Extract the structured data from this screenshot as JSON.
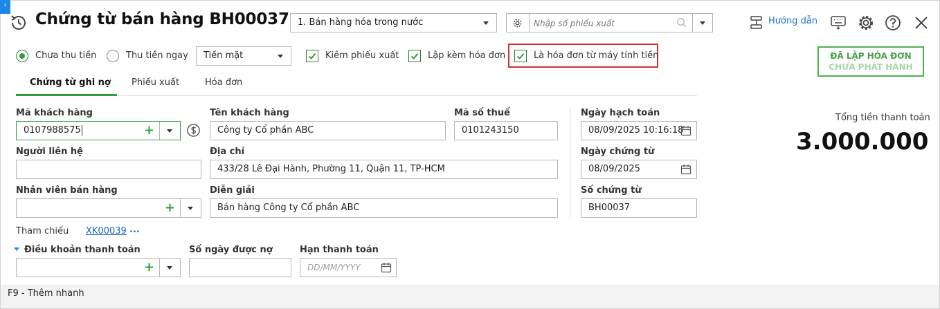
{
  "corner": {
    "glyph": "›"
  },
  "header": {
    "title": "Chứng từ bán hàng BH00037",
    "sale_type": "1. Bán hàng hóa trong nước",
    "search_placeholder": "Nhập số phiếu xuất",
    "guide_label": "Hướng dẫn"
  },
  "options": {
    "unpaid_label": "Chưa thu tiền",
    "paid_now_label": "Thu tiền ngay",
    "payment_method": "Tiền mặt",
    "with_delivery_label": "Kiêm phiếu xuất",
    "with_invoice_label": "Lập kèm hóa đơn",
    "cash_register_label": "Là hóa đơn từ máy tính tiền"
  },
  "status_badge": {
    "line1": "ĐÃ LẬP HÓA ĐƠN",
    "line2": "CHƯA PHÁT HÀNH"
  },
  "tabs": [
    {
      "label": "Chứng từ ghi nợ",
      "active": true
    },
    {
      "label": "Phiếu xuất",
      "active": false
    },
    {
      "label": "Hóa đơn",
      "active": false
    }
  ],
  "form": {
    "customer_code_label": "Mã khách hàng",
    "customer_code": "0107988575",
    "customer_name_label": "Tên khách hàng",
    "customer_name": "Công ty Cổ phần ABC",
    "tax_code_label": "Mã số thuế",
    "tax_code": "0101243150",
    "contact_label": "Người liên hệ",
    "contact": "",
    "address_label": "Địa chỉ",
    "address": "433/28 Lê Đại Hành, Phường 11, Quận 11, TP-HCM",
    "salesperson_label": "Nhân viên bán hàng",
    "salesperson": "",
    "description_label": "Diễn giải",
    "description": "Bán hàng Công ty Cổ phần ABC",
    "reference_label": "Tham chiếu",
    "reference_link": "XK00039",
    "reference_more": "...",
    "payment_terms_label": "Điều khoản thanh toán",
    "payment_terms": "",
    "credit_days_label": "Số ngày được nợ",
    "credit_days": "",
    "due_date_label": "Hạn thanh toán",
    "due_date_placeholder": "DD/MM/YYYY"
  },
  "dates": {
    "posting_date_label": "Ngày hạch toán",
    "posting_date": "08/09/2025 10:16:18",
    "voucher_date_label": "Ngày chứng từ",
    "voucher_date": "08/09/2025",
    "voucher_no_label": "Số chứng từ",
    "voucher_no": "BH00037"
  },
  "total": {
    "label": "Tổng tiền thanh toán",
    "value": "3.000.000"
  },
  "footer": {
    "hint": "F9 - Thêm nhanh"
  },
  "colors": {
    "accent_green": "#2e9e3f",
    "link_blue": "#1565c0",
    "highlight_red": "#d32f2f"
  }
}
